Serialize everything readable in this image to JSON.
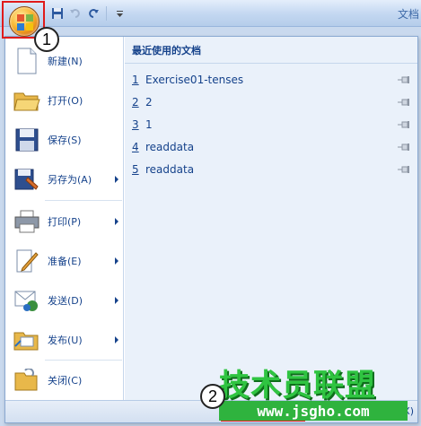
{
  "window": {
    "title": "文档"
  },
  "callouts": {
    "one": "1",
    "two": "2"
  },
  "menu": {
    "items": [
      {
        "label": "新建(N)",
        "icon": "new-document-icon",
        "submenu": false
      },
      {
        "label": "打开(O)",
        "icon": "open-folder-icon",
        "submenu": false
      },
      {
        "label": "保存(S)",
        "icon": "save-disk-icon",
        "submenu": false
      },
      {
        "label": "另存为(A)",
        "icon": "save-as-icon",
        "submenu": true
      },
      {
        "label": "打印(P)",
        "icon": "printer-icon",
        "submenu": true
      },
      {
        "label": "准备(E)",
        "icon": "prepare-icon",
        "submenu": true
      },
      {
        "label": "发送(D)",
        "icon": "send-icon",
        "submenu": true
      },
      {
        "label": "发布(U)",
        "icon": "publish-icon",
        "submenu": true
      },
      {
        "label": "关闭(C)",
        "icon": "close-folder-icon",
        "submenu": false
      }
    ]
  },
  "recent": {
    "header": "最近使用的文档",
    "items": [
      {
        "num": "1",
        "name": "Exercise01-tenses"
      },
      {
        "num": "2",
        "name": "2"
      },
      {
        "num": "3",
        "name": "1"
      },
      {
        "num": "4",
        "name": "readdata"
      },
      {
        "num": "5",
        "name": "readdata"
      }
    ]
  },
  "bottom": {
    "exit_partial": "rd(X)"
  },
  "watermark": {
    "brand": "技术员联盟",
    "url": "www.jsgho.com"
  },
  "colors": {
    "accent": "#15428b",
    "highlight": "#e01b1b",
    "watermark": "#2fc441"
  }
}
